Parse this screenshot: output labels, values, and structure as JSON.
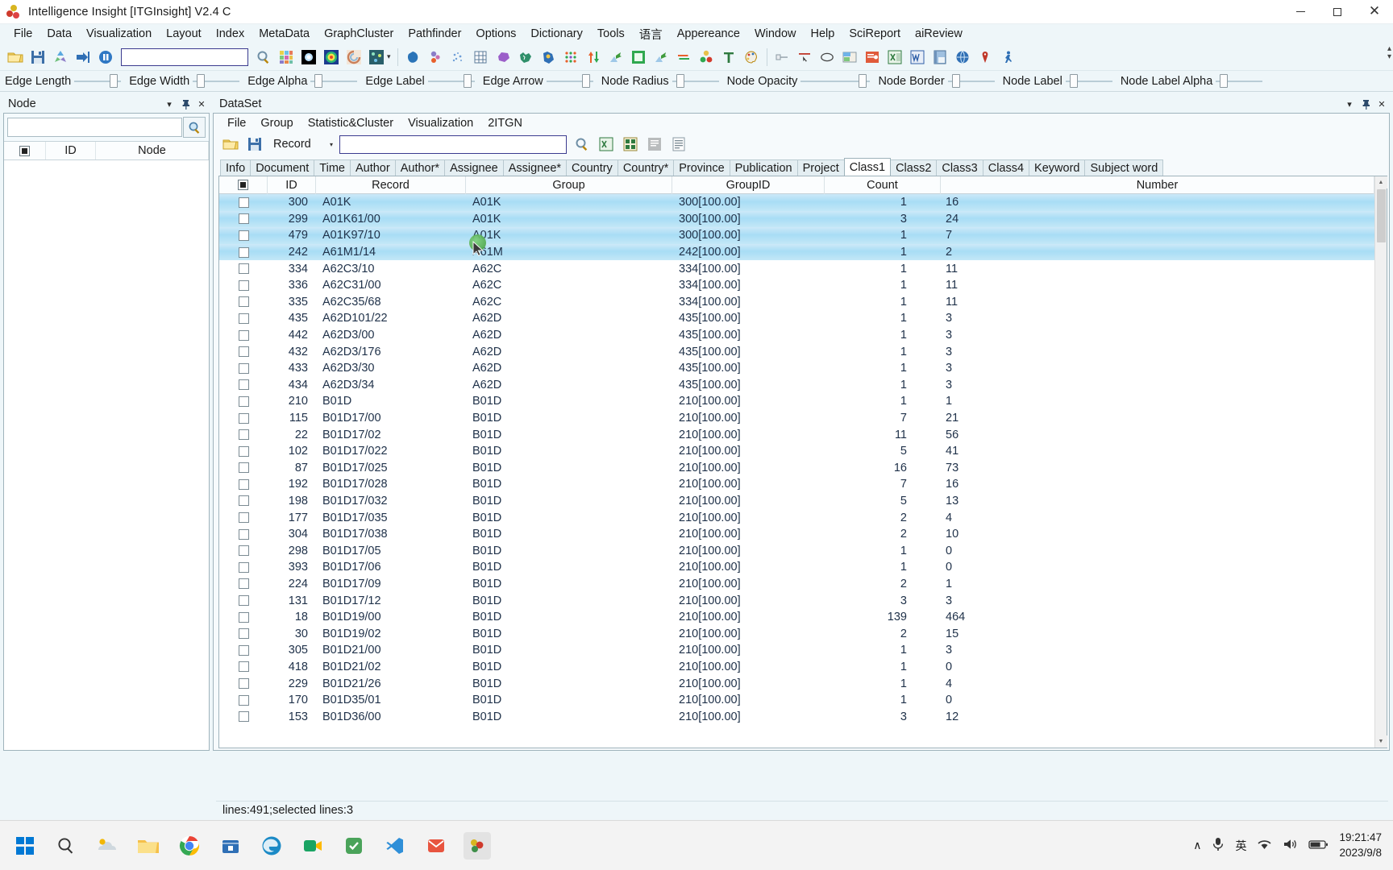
{
  "window": {
    "title": "Intelligence Insight [ITGInsight] V2.4 C",
    "app_icon": "molecule-icon",
    "minimize": "—",
    "maximize": "□",
    "close": "✕"
  },
  "menubar": {
    "items": [
      {
        "label": "File",
        "name": "menu-file"
      },
      {
        "label": "Data",
        "name": "menu-data"
      },
      {
        "label": "Visualization",
        "name": "menu-visualization"
      },
      {
        "label": "Layout",
        "name": "menu-layout"
      },
      {
        "label": "Index",
        "name": "menu-index"
      },
      {
        "label": "MetaData",
        "name": "menu-metadata"
      },
      {
        "label": "GraphCluster",
        "name": "menu-graphcluster"
      },
      {
        "label": "Pathfinder",
        "name": "menu-pathfinder"
      },
      {
        "label": "Options",
        "name": "menu-options"
      },
      {
        "label": "Dictionary",
        "name": "menu-dictionary"
      },
      {
        "label": "Tools",
        "name": "menu-tools"
      },
      {
        "label": "语言",
        "name": "menu-language"
      },
      {
        "label": "Appereance",
        "name": "menu-appereance"
      },
      {
        "label": "Window",
        "name": "menu-window"
      },
      {
        "label": "Help",
        "name": "menu-help"
      },
      {
        "label": "SciReport",
        "name": "menu-scireport"
      },
      {
        "label": "aiReview",
        "name": "menu-aireview"
      }
    ]
  },
  "toolbar": {
    "search_value": "",
    "overflow_label": "▾"
  },
  "sliders": [
    {
      "label": "Edge Length",
      "track": 58,
      "knob": 44
    },
    {
      "label": "Edge Width",
      "track": 58,
      "knob": 5
    },
    {
      "label": "Edge Alpha",
      "track": 58,
      "knob": 5
    },
    {
      "label": "Edge Label",
      "track": 58,
      "knob": 44
    },
    {
      "label": "Edge Arrow",
      "track": 58,
      "knob": 44
    },
    {
      "label": "Node Radius",
      "track": 58,
      "knob": 5
    },
    {
      "label": "Node Opacity",
      "track": 86,
      "knob": 72
    },
    {
      "label": "Node Border",
      "track": 58,
      "knob": 5
    },
    {
      "label": "Node Label",
      "track": 58,
      "knob": 5
    },
    {
      "label": "Node Label Alpha",
      "track": 58,
      "knob": 5
    }
  ],
  "left_panel": {
    "title": "Node",
    "dropdown_icon": "▾",
    "pin_icon": "⚓",
    "close_icon": "✕",
    "search_placeholder": "",
    "search_value": "",
    "search_button_icon": "magnifier-icon",
    "columns": [
      "ID",
      "Node"
    ]
  },
  "dataset": {
    "title": "DataSet",
    "dropdown_icon": "▾",
    "pin_icon": "⚓",
    "close_icon": "✕",
    "menu": [
      {
        "label": "File",
        "name": "ds-menu-file"
      },
      {
        "label": "Group",
        "name": "ds-menu-group"
      },
      {
        "label": "Statistic&Cluster",
        "name": "ds-menu-statistic-cluster"
      },
      {
        "label": "Visualization",
        "name": "ds-menu-visualization"
      },
      {
        "label": "2ITGN",
        "name": "ds-menu-2itgn"
      }
    ],
    "combo_value": "Record",
    "combo_arrow": "▾",
    "search_value": "",
    "tabs": [
      {
        "label": "Info",
        "active": false
      },
      {
        "label": "Document",
        "active": false
      },
      {
        "label": "Time",
        "active": false
      },
      {
        "label": "Author",
        "active": false
      },
      {
        "label": "Author*",
        "active": false
      },
      {
        "label": "Assignee",
        "active": false
      },
      {
        "label": "Assignee*",
        "active": false
      },
      {
        "label": "Country",
        "active": false
      },
      {
        "label": "Country*",
        "active": false
      },
      {
        "label": "Province",
        "active": false
      },
      {
        "label": "Publication",
        "active": false
      },
      {
        "label": "Project",
        "active": false
      },
      {
        "label": "Class1",
        "active": true
      },
      {
        "label": "Class2",
        "active": false
      },
      {
        "label": "Class3",
        "active": false
      },
      {
        "label": "Class4",
        "active": false
      },
      {
        "label": "Keyword",
        "active": false
      },
      {
        "label": "Subject word",
        "active": false
      }
    ],
    "grid": {
      "columns": [
        "ID",
        "Record",
        "Group",
        "GroupID",
        "Count",
        "Number"
      ],
      "select_all_icon": "select-all-checkbox",
      "rows": [
        {
          "id": "300",
          "record": "A01K",
          "group": "A01K",
          "groupid": "300[100.00]",
          "count": "1",
          "number": "16",
          "selected": true
        },
        {
          "id": "299",
          "record": "A01K61/00",
          "group": "A01K",
          "groupid": "300[100.00]",
          "count": "3",
          "number": "24",
          "selected": true
        },
        {
          "id": "479",
          "record": "A01K97/10",
          "group": "A01K",
          "groupid": "300[100.00]",
          "count": "1",
          "number": "7",
          "selected": true
        },
        {
          "id": "242",
          "record": "A61M1/14",
          "group": "A61M",
          "groupid": "242[100.00]",
          "count": "1",
          "number": "2",
          "selected": true
        },
        {
          "id": "334",
          "record": "A62C3/10",
          "group": "A62C",
          "groupid": "334[100.00]",
          "count": "1",
          "number": "11",
          "selected": false
        },
        {
          "id": "336",
          "record": "A62C31/00",
          "group": "A62C",
          "groupid": "334[100.00]",
          "count": "1",
          "number": "11",
          "selected": false
        },
        {
          "id": "335",
          "record": "A62C35/68",
          "group": "A62C",
          "groupid": "334[100.00]",
          "count": "1",
          "number": "11",
          "selected": false
        },
        {
          "id": "435",
          "record": "A62D101/22",
          "group": "A62D",
          "groupid": "435[100.00]",
          "count": "1",
          "number": "3",
          "selected": false
        },
        {
          "id": "442",
          "record": "A62D3/00",
          "group": "A62D",
          "groupid": "435[100.00]",
          "count": "1",
          "number": "3",
          "selected": false
        },
        {
          "id": "432",
          "record": "A62D3/176",
          "group": "A62D",
          "groupid": "435[100.00]",
          "count": "1",
          "number": "3",
          "selected": false
        },
        {
          "id": "433",
          "record": "A62D3/30",
          "group": "A62D",
          "groupid": "435[100.00]",
          "count": "1",
          "number": "3",
          "selected": false
        },
        {
          "id": "434",
          "record": "A62D3/34",
          "group": "A62D",
          "groupid": "435[100.00]",
          "count": "1",
          "number": "3",
          "selected": false
        },
        {
          "id": "210",
          "record": "B01D",
          "group": "B01D",
          "groupid": "210[100.00]",
          "count": "1",
          "number": "1",
          "selected": false
        },
        {
          "id": "115",
          "record": "B01D17/00",
          "group": "B01D",
          "groupid": "210[100.00]",
          "count": "7",
          "number": "21",
          "selected": false
        },
        {
          "id": "22",
          "record": "B01D17/02",
          "group": "B01D",
          "groupid": "210[100.00]",
          "count": "11",
          "number": "56",
          "selected": false
        },
        {
          "id": "102",
          "record": "B01D17/022",
          "group": "B01D",
          "groupid": "210[100.00]",
          "count": "5",
          "number": "41",
          "selected": false
        },
        {
          "id": "87",
          "record": "B01D17/025",
          "group": "B01D",
          "groupid": "210[100.00]",
          "count": "16",
          "number": "73",
          "selected": false
        },
        {
          "id": "192",
          "record": "B01D17/028",
          "group": "B01D",
          "groupid": "210[100.00]",
          "count": "7",
          "number": "16",
          "selected": false
        },
        {
          "id": "198",
          "record": "B01D17/032",
          "group": "B01D",
          "groupid": "210[100.00]",
          "count": "5",
          "number": "13",
          "selected": false
        },
        {
          "id": "177",
          "record": "B01D17/035",
          "group": "B01D",
          "groupid": "210[100.00]",
          "count": "2",
          "number": "4",
          "selected": false
        },
        {
          "id": "304",
          "record": "B01D17/038",
          "group": "B01D",
          "groupid": "210[100.00]",
          "count": "2",
          "number": "10",
          "selected": false
        },
        {
          "id": "298",
          "record": "B01D17/05",
          "group": "B01D",
          "groupid": "210[100.00]",
          "count": "1",
          "number": "0",
          "selected": false
        },
        {
          "id": "393",
          "record": "B01D17/06",
          "group": "B01D",
          "groupid": "210[100.00]",
          "count": "1",
          "number": "0",
          "selected": false
        },
        {
          "id": "224",
          "record": "B01D17/09",
          "group": "B01D",
          "groupid": "210[100.00]",
          "count": "2",
          "number": "1",
          "selected": false
        },
        {
          "id": "131",
          "record": "B01D17/12",
          "group": "B01D",
          "groupid": "210[100.00]",
          "count": "3",
          "number": "3",
          "selected": false
        },
        {
          "id": "18",
          "record": "B01D19/00",
          "group": "B01D",
          "groupid": "210[100.00]",
          "count": "139",
          "number": "464",
          "selected": false
        },
        {
          "id": "30",
          "record": "B01D19/02",
          "group": "B01D",
          "groupid": "210[100.00]",
          "count": "2",
          "number": "15",
          "selected": false
        },
        {
          "id": "305",
          "record": "B01D21/00",
          "group": "B01D",
          "groupid": "210[100.00]",
          "count": "1",
          "number": "3",
          "selected": false
        },
        {
          "id": "418",
          "record": "B01D21/02",
          "group": "B01D",
          "groupid": "210[100.00]",
          "count": "1",
          "number": "0",
          "selected": false
        },
        {
          "id": "229",
          "record": "B01D21/26",
          "group": "B01D",
          "groupid": "210[100.00]",
          "count": "1",
          "number": "4",
          "selected": false
        },
        {
          "id": "170",
          "record": "B01D35/01",
          "group": "B01D",
          "groupid": "210[100.00]",
          "count": "1",
          "number": "0",
          "selected": false
        },
        {
          "id": "153",
          "record": "B01D36/00",
          "group": "B01D",
          "groupid": "210[100.00]",
          "count": "3",
          "number": "12",
          "selected": false
        }
      ]
    }
  },
  "statusbar": {
    "text": "lines:491;selected lines:3"
  },
  "taskbar": {
    "start_icon": "windows-logo-icon",
    "items": [
      {
        "name": "search-icon"
      },
      {
        "name": "widgets-weather-icon"
      },
      {
        "name": "file-explorer-icon"
      },
      {
        "name": "chrome-icon"
      },
      {
        "name": "store-icon"
      },
      {
        "name": "edge-icon"
      },
      {
        "name": "teams-meet-icon"
      },
      {
        "name": "app-green-icon"
      },
      {
        "name": "vscode-icon"
      },
      {
        "name": "mail-icon"
      },
      {
        "name": "itginsight-icon"
      }
    ],
    "tray": {
      "chevron": "∧",
      "mic_icon": "microphone-icon",
      "ime_label": "英",
      "wifi_icon": "wifi-icon",
      "volume_icon": "speaker-icon",
      "battery_icon": "battery-icon",
      "time": "19:21:47",
      "date": "2023/9/8"
    }
  }
}
